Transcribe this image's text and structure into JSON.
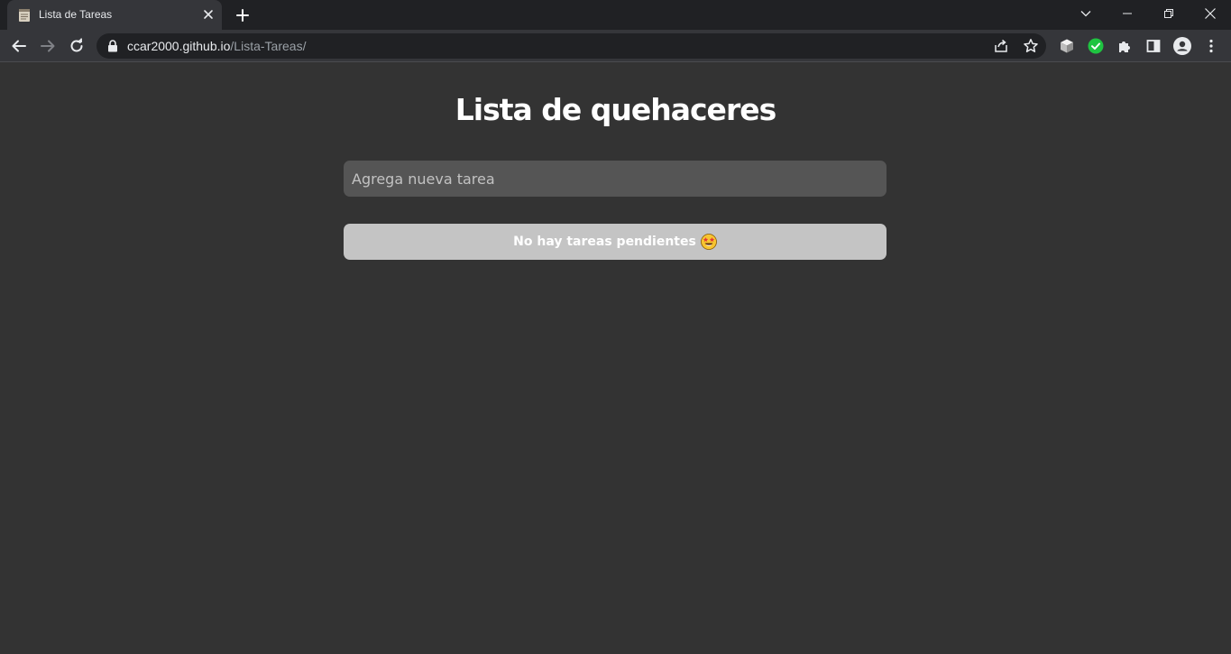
{
  "browser": {
    "tab": {
      "title": "Lista de Tareas"
    },
    "address": {
      "host": "ccar2000.github.io",
      "path": "/Lista-Tareas/"
    }
  },
  "app": {
    "heading": "Lista de quehaceres",
    "input": {
      "placeholder": "Agrega nueva tarea",
      "value": ""
    },
    "empty_message": "No hay tareas pendientes",
    "empty_icon": "star-struck-emoji"
  },
  "colors": {
    "background": "#333333",
    "input_bg": "#555555",
    "empty_bg": "#c4c4c4",
    "heading": "#ffffff"
  }
}
